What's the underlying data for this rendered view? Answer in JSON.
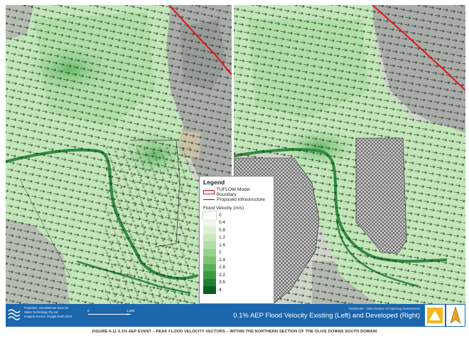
{
  "legend": {
    "title": "Legend",
    "model_boundary_label": "TUFLOW Model Boundary",
    "infrastructure_label": "Proposed Infrastructure",
    "velocity_heading": "Flood Velocity (m/s)",
    "velocity_bins": [
      "0",
      "0.4",
      "0.8",
      "1.2",
      "1.6",
      "2",
      "2.4",
      "2.8",
      "3.2",
      "3.6",
      "4"
    ],
    "velocity_colors": [
      "#ffffff",
      "#edf7e9",
      "#dcf0d5",
      "#c9e8c0",
      "#b1dea6",
      "#97d18b",
      "#7cc371",
      "#5ab05a",
      "#3b9a45",
      "#1f7f32",
      "#0b5e1f"
    ],
    "boundary_color": "#e1141a"
  },
  "info_bar": {
    "projection": "Projection: GDA/MGA94 Zone 55",
    "company": "Water Technology Pty Ltd",
    "imagery": "Imagery Source: Google Earth 2019",
    "scale_start": "0",
    "scale_end": "1,000 m",
    "project": "Pembroke - Olive Downs Vs Namnog Investments",
    "map_title": "0.1% AEP Flood Velocity Existing (Left) and Developed (Right)"
  },
  "caption": "FIGURE 4-11      0.1% AEP EVENT – PEAK FLOOD VELOCITY VECTORS – WITHIN THE NORTHERN SECTION OF THE OLIVE DOWNS SOUTH DOMAIN"
}
